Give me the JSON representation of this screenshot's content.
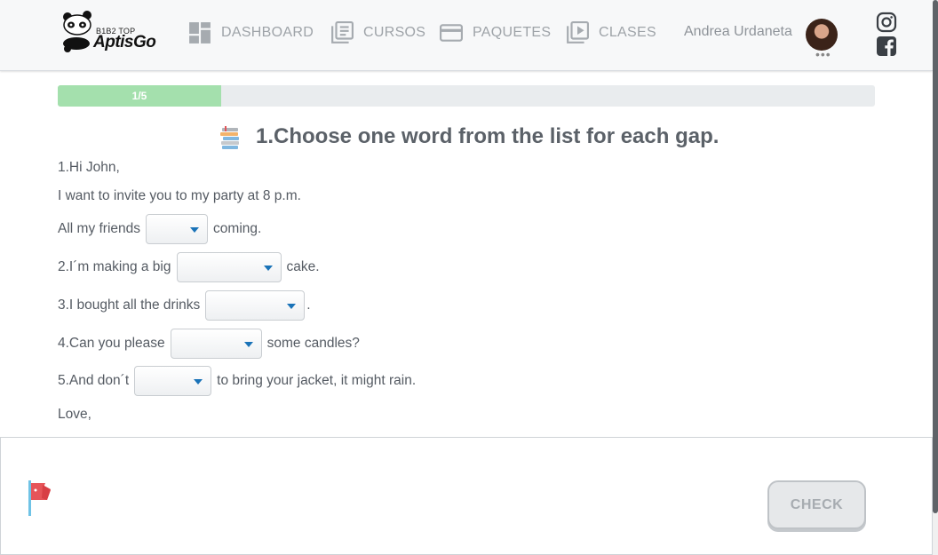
{
  "brand": {
    "top": "B1B2 TOP",
    "name": "AptisGo"
  },
  "nav": [
    {
      "label": "DASHBOARD",
      "icon": "dashboard-icon"
    },
    {
      "label": "CURSOS",
      "icon": "book-icon"
    },
    {
      "label": "PAQUETES",
      "icon": "card-icon"
    },
    {
      "label": "CLASES",
      "icon": "video-library-icon"
    }
  ],
  "user": {
    "name": "Andrea Urdaneta",
    "more": "•••"
  },
  "social": [
    "instagram-icon",
    "facebook-icon"
  ],
  "progress": {
    "label": "1/5",
    "fraction": 0.2
  },
  "question": {
    "title": "1.Choose one word from the list for each gap.",
    "icon": "books-icon"
  },
  "lines": {
    "l1": "1.Hi John,",
    "l2": "I want to invite you to my party at 8 p.m.",
    "l3a": "All my friends",
    "l3b": "coming.",
    "l4a": "2.I´m making a big",
    "l4b": "cake.",
    "l5a": "3.I bought all the drinks",
    "l5b": ".",
    "l6a": "4.Can you please",
    "l6b": "some candles?",
    "l7a": "5.And don´t",
    "l7b": "to bring your jacket, it might rain.",
    "l8": "Love,"
  },
  "selects": {
    "gap1": "",
    "gap2": "",
    "gap3": "",
    "gap4": "",
    "gap5": ""
  },
  "footer": {
    "check_label": "CHECK",
    "flag_icon": "report-flag-icon"
  },
  "colors": {
    "progress": "#a4e0ad",
    "caret": "#1a73b8",
    "nav": "#9ea3a8"
  }
}
